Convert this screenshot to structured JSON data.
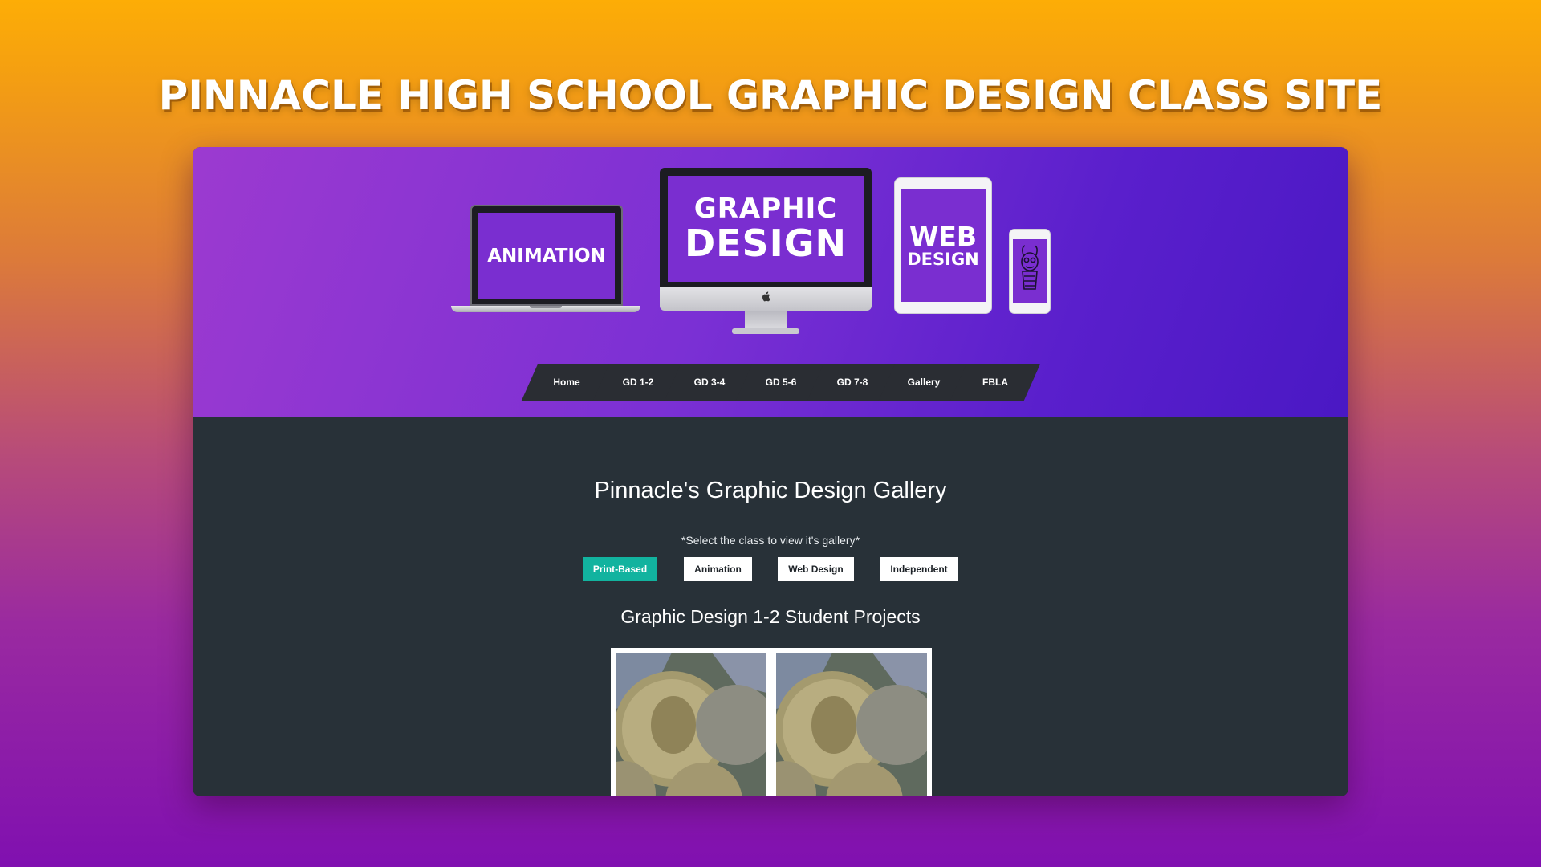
{
  "page_title": "PINNACLE HIGH SCHOOL GRAPHIC DESIGN CLASS SITE",
  "hero": {
    "laptop_label": "ANIMATION",
    "imac_line1": "GRAPHIC",
    "imac_line2": "DESIGN",
    "tablet_line1": "WEB",
    "tablet_line2": "DESIGN"
  },
  "nav": {
    "items": [
      {
        "label": "Home"
      },
      {
        "label": "GD 1-2"
      },
      {
        "label": "GD 3-4"
      },
      {
        "label": "GD 5-6"
      },
      {
        "label": "GD 7-8"
      },
      {
        "label": "Gallery"
      },
      {
        "label": "FBLA"
      }
    ]
  },
  "gallery": {
    "title": "Pinnacle's Graphic Design Gallery",
    "hint": "*Select the class to view it's gallery*",
    "filters": [
      {
        "label": "Print-Based",
        "active": true
      },
      {
        "label": "Animation",
        "active": false
      },
      {
        "label": "Web Design",
        "active": false
      },
      {
        "label": "Independent",
        "active": false
      }
    ],
    "projects_title": "Graphic Design 1-2 Student Projects"
  },
  "colors": {
    "accent": "#12b39f",
    "header_purple": "#7b30d4",
    "content_bg": "#283138",
    "nav_bg": "#2a2d33"
  }
}
